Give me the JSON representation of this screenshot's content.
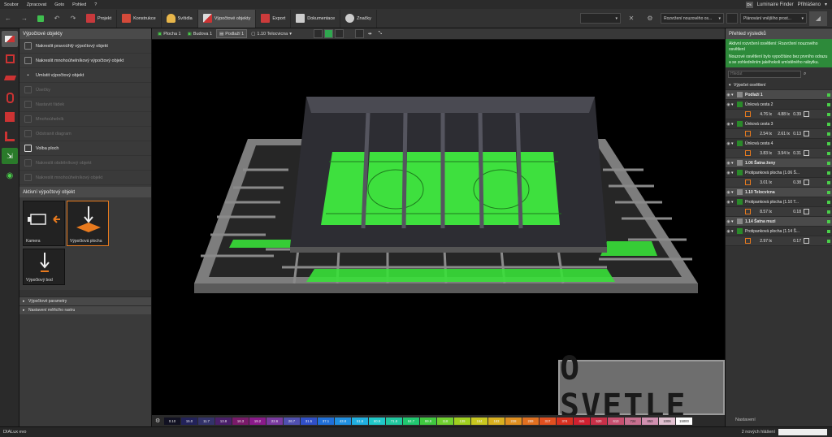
{
  "menubar": {
    "items": [
      "Soubor",
      "Zpracovat",
      "Goto",
      "Pohled",
      "?"
    ],
    "luminaire_finder": "Luminaire Finder",
    "login": "Přihlášeno",
    "logo": "Dx"
  },
  "toolbar": {
    "tabs": [
      {
        "label": "Projekt",
        "color": "#c8393c"
      },
      {
        "label": "Konstrukce",
        "color": "#d44a3a"
      },
      {
        "label": "Svítidla",
        "color": "#e8b64a"
      },
      {
        "label": "Výpočtové objekty",
        "color": "#3a3a3a"
      },
      {
        "label": "Export",
        "color": "#cc3b3b"
      },
      {
        "label": "Dokumentace",
        "color": "#cccccc"
      },
      {
        "label": "Značky",
        "color": "#cccccc"
      }
    ],
    "active_tab": "Výpočtové objekty",
    "select1": "Rozvržení nouzového os...",
    "select2": "Plánování vnějšího prost..."
  },
  "left_panel": {
    "header": "Výpočtové objekty",
    "options": [
      {
        "label": "Nakreslit pravoúhlý výpočtový objekt",
        "enabled": true
      },
      {
        "label": "Nakreslit mnohoúhelníkový výpočtový objekt",
        "enabled": true
      },
      {
        "label": "Umístit výpočtový objekt",
        "enabled": true
      },
      {
        "label": "Úsečky",
        "enabled": false
      },
      {
        "label": "Nastavit řádek",
        "enabled": false
      },
      {
        "label": "Mnohoúhelník",
        "enabled": false
      },
      {
        "label": "Odstranit diagram",
        "enabled": false
      },
      {
        "label": "Volba ploch",
        "enabled": true
      },
      {
        "label": "Nakreslit obdélníkový objekt",
        "enabled": false
      },
      {
        "label": "Nakreslit mnohoúhelníkový objekt",
        "enabled": false
      }
    ],
    "active_header": "Aktivní výpočtový objekt",
    "tiles": [
      "Kamera",
      "Výpočtová plocha",
      "Výpočtový bod"
    ],
    "collapsed": [
      "Výpočtové parametry",
      "Nastavení měřicího rastru"
    ]
  },
  "viewport_toolbar": {
    "crumbs": [
      "Plocha 1",
      "Budova 1",
      "Podlaží 1",
      "1.10 Telocvicna"
    ]
  },
  "scale": {
    "values": [
      "0.10",
      "15.0",
      "11.7",
      "13.8",
      "16.3",
      "19.2",
      "22.6",
      "26.7",
      "31.5",
      "37.1",
      "43.8",
      "51.6",
      "60.9",
      "71.8",
      "84.7",
      "99.9",
      "118",
      "139",
      "164",
      "193",
      "228",
      "269",
      "317",
      "374",
      "441",
      "520",
      "613",
      "724",
      "853",
      "1006",
      "15000"
    ],
    "colors": [
      "#111122",
      "#22225a",
      "#33336a",
      "#4a1f6a",
      "#7a1a6a",
      "#8a1a8a",
      "#7a3aa0",
      "#5050b0",
      "#3050c8",
      "#2070d8",
      "#2090e0",
      "#20b0e0",
      "#20c8c8",
      "#20c8a0",
      "#20c870",
      "#40c840",
      "#70d030",
      "#a0d020",
      "#c8c820",
      "#d8b020",
      "#e09020",
      "#e07020",
      "#e05020",
      "#d83020",
      "#d02030",
      "#c83048",
      "#c85070",
      "#c87090",
      "#d090b0",
      "#e0c0d0",
      "#ffffff"
    ]
  },
  "right_panel": {
    "header": "Přehled výsledků",
    "notice_title": "Aktivní rozvržení osvětlení: Rozvržení nouzového osvětlení",
    "notice_body": "Nouzové osvětlení bylo vypočítáno bez prvního odrazu a se zohledněním jakéhokoli umístěného nábytku.",
    "search_placeholder": "Hledat",
    "section": "Výpočet osvětlení",
    "groups": [
      {
        "name": "Podlaží 1",
        "type": "group"
      },
      {
        "name": "Únková cesta 2",
        "type": "item",
        "v1": "4.76 lx",
        "v2": "4.88 lx",
        "v3": "0.39"
      },
      {
        "name": "Únková cesta 3",
        "type": "item",
        "v1": "2.54 lx",
        "v2": "2.61 lx",
        "v3": "0.13"
      },
      {
        "name": "Únková cesta 4",
        "type": "item",
        "v1": "3.83 lx",
        "v2": "3.94 lx",
        "v3": "0.31"
      },
      {
        "name": "1.06 Šatna ženy",
        "type": "group"
      },
      {
        "name": "Protipanková plocha (1.06 Š...",
        "type": "item",
        "v1": "3.01 lx",
        "v2": "",
        "v3": "0.38"
      },
      {
        "name": "1.10 Telocvicna",
        "type": "group"
      },
      {
        "name": "Protipanková plocha (1.10 T...",
        "type": "item",
        "v1": "8.57 lx",
        "v2": "",
        "v3": "0.18"
      },
      {
        "name": "1.14 Šatna muzi",
        "type": "group"
      },
      {
        "name": "Protipanková plocha (1.14 Š...",
        "type": "item",
        "v1": "2.97 lx",
        "v2": "",
        "v3": "0.17"
      }
    ]
  },
  "watermark": "O SVETLE",
  "status": {
    "brand": "DIALux evo",
    "messages": "2 nových hlášení",
    "settings": "Nastavení"
  }
}
